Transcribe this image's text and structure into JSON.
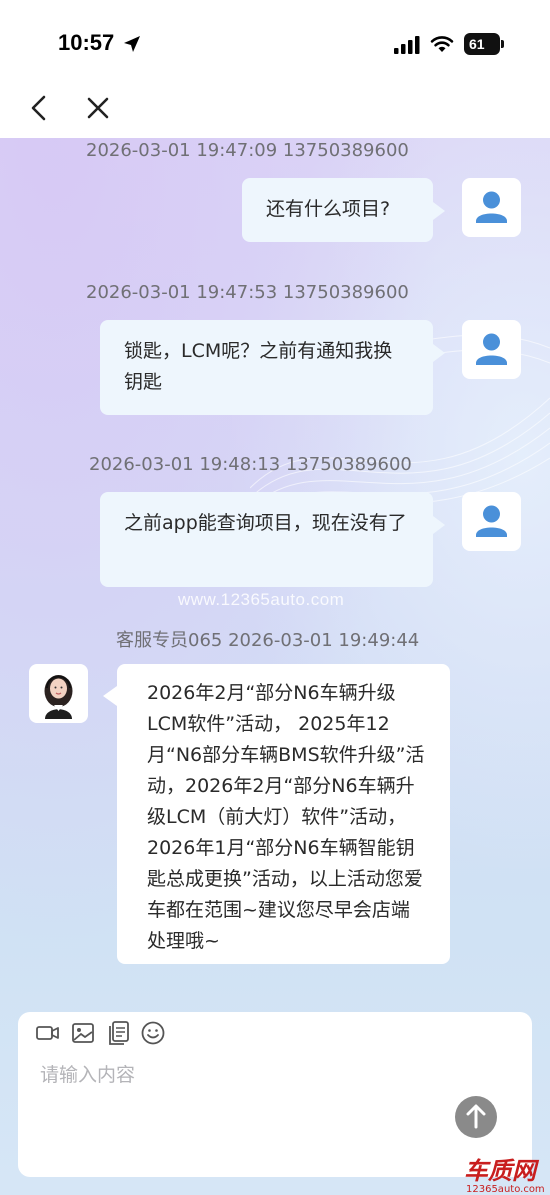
{
  "status_bar": {
    "time": "10:57",
    "battery": "61"
  },
  "nav": {
    "back_icon": "chevron-left-icon",
    "close_icon": "close-icon"
  },
  "messages": [
    {
      "meta": "2026-03-01 19:47:09   13750389600",
      "text": "还有什么项目?"
    },
    {
      "meta": "2026-03-01 19:47:53   13750389600",
      "text": "锁匙，LCM呢？之前有通知我换钥匙"
    },
    {
      "meta": "2026-03-01 19:48:13   13750389600",
      "text": "之前app能查询项目，现在没有了"
    },
    {
      "meta": "客服专员065   2026-03-01 19:49:44",
      "text": "2026年2月“部分N6车辆升级LCM软件”活动， 2025年12月“N6部分车辆BMS软件升级”活动，2026年2月“部分N6车辆升级LCM（前大灯）软件”活动，2026年1月“部分N6车辆智能钥匙总成更换”活动，以上活动您爱车都在范围~建议您尽早会店端处理哦~"
    }
  ],
  "watermark": "www.12365auto.com",
  "input": {
    "placeholder": "请输入内容",
    "value": "",
    "tools": [
      "video-icon",
      "image-icon",
      "file-icon",
      "emoji-icon"
    ]
  },
  "send_icon": "arrow-up-icon",
  "logo": {
    "name": "车质网",
    "url_text": "12365auto.com",
    "color": "#c81e1e"
  }
}
